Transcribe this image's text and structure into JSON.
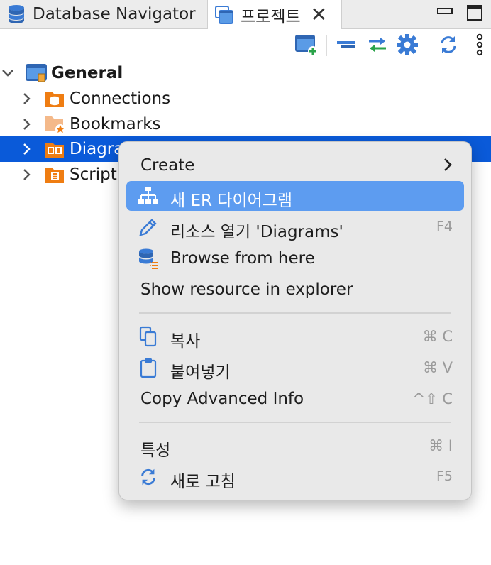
{
  "tabs": {
    "db_navigator": "Database Navigator",
    "project": "프로젝트"
  },
  "tree": {
    "root": "General",
    "items": [
      {
        "label": "Connections"
      },
      {
        "label": "Bookmarks"
      },
      {
        "label": "Diagra"
      },
      {
        "label": "Script"
      }
    ]
  },
  "menu": {
    "create": "Create",
    "new_er": "새 ER 다이어그램",
    "open_resource": "리소스 열기 'Diagrams'",
    "open_resource_shortcut": "F4",
    "browse": "Browse from here",
    "show_explorer": "Show resource in explorer",
    "copy": "복사",
    "copy_shortcut": "⌘ C",
    "paste": "붙여넣기",
    "paste_shortcut": "⌘ V",
    "copy_adv": "Copy Advanced Info",
    "copy_adv_shortcut": "^⇧ C",
    "properties": "특성",
    "properties_shortcut": "⌘ I",
    "refresh": "새로 고침",
    "refresh_shortcut": "F5"
  },
  "colors": {
    "selection": "#0a5ad9",
    "menu_highlight": "#5d9cf0",
    "folder_orange": "#ef7d12",
    "db_blue": "#3a7bd5"
  }
}
